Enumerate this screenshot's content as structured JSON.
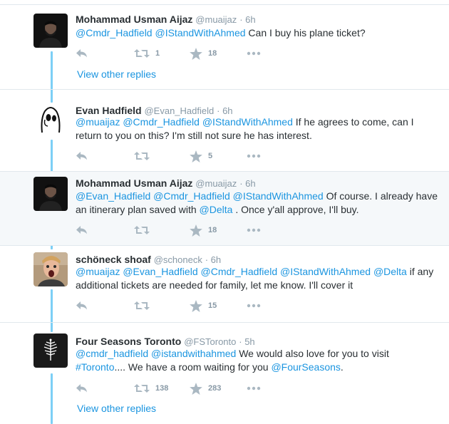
{
  "tweets": [
    {
      "name": "Mohammad Usman Aijaz",
      "handle": "@muaijaz",
      "time": "· 6h",
      "parts": [
        {
          "t": "@Cmdr_Hadfield",
          "m": true
        },
        {
          "t": " ",
          "m": false
        },
        {
          "t": "@IStandWithAhmed",
          "m": true
        },
        {
          "t": " Can I buy his plane ticket?",
          "m": false
        }
      ],
      "retweets": "1",
      "likes": "18",
      "view_other": "View other replies"
    },
    {
      "name": "Evan Hadfield",
      "handle": "@Evan_Hadfield",
      "time": "· 6h",
      "parts": [
        {
          "t": "@muaijaz",
          "m": true
        },
        {
          "t": " ",
          "m": false
        },
        {
          "t": "@Cmdr_Hadfield",
          "m": true
        },
        {
          "t": " ",
          "m": false
        },
        {
          "t": "@IStandWithAhmed",
          "m": true
        },
        {
          "t": "  If he agrees to come, can I return to you on this? I'm still not sure he has interest.",
          "m": false
        }
      ],
      "retweets": "",
      "likes": "5"
    },
    {
      "name": "Mohammad Usman Aijaz",
      "handle": "@muaijaz",
      "time": "· 6h",
      "parts": [
        {
          "t": "@Evan_Hadfield",
          "m": true
        },
        {
          "t": " ",
          "m": false
        },
        {
          "t": "@Cmdr_Hadfield",
          "m": true
        },
        {
          "t": " ",
          "m": false
        },
        {
          "t": "@IStandWithAhmed",
          "m": true
        },
        {
          "t": " Of course. I already have an itinerary plan saved with ",
          "m": false
        },
        {
          "t": "@Delta",
          "m": true
        },
        {
          "t": " . Once y'all approve, I'll buy.",
          "m": false
        }
      ],
      "retweets": "",
      "likes": "18"
    },
    {
      "name": "schöneck shoaf",
      "handle": "@schoneck",
      "time": "· 6h",
      "parts": [
        {
          "t": "@muaijaz",
          "m": true
        },
        {
          "t": " ",
          "m": false
        },
        {
          "t": "@Evan_Hadfield",
          "m": true
        },
        {
          "t": " ",
          "m": false
        },
        {
          "t": "@Cmdr_Hadfield",
          "m": true
        },
        {
          "t": " ",
          "m": false
        },
        {
          "t": "@IStandWithAhmed",
          "m": true
        },
        {
          "t": " ",
          "m": false
        },
        {
          "t": "@Delta",
          "m": true
        },
        {
          "t": " if any additional tickets are needed for family, let me know. I'll cover it",
          "m": false
        }
      ],
      "retweets": "",
      "likes": "15"
    },
    {
      "name": "Four Seasons Toronto",
      "handle": "@FSToronto",
      "time": "· 5h",
      "parts": [
        {
          "t": "@cmdr_hadfield",
          "m": true
        },
        {
          "t": " ",
          "m": false
        },
        {
          "t": "@istandwithahmed",
          "m": true
        },
        {
          "t": " We would also love for you to visit ",
          "m": false
        },
        {
          "t": "#Toronto",
          "m": true
        },
        {
          "t": ".... We have a room waiting for you ",
          "m": false
        },
        {
          "t": "@FourSeasons",
          "m": true
        },
        {
          "t": ".",
          "m": false
        }
      ],
      "retweets": "138",
      "likes": "283",
      "view_other": "View other replies"
    }
  ],
  "colors": {
    "link": "#1b95e0",
    "thread_line": "#7ccff6",
    "icon": "#aab8c2",
    "meta": "#8899a6"
  },
  "icons": [
    "reply-icon",
    "retweet-icon",
    "like-star-icon",
    "more-options-icon"
  ]
}
